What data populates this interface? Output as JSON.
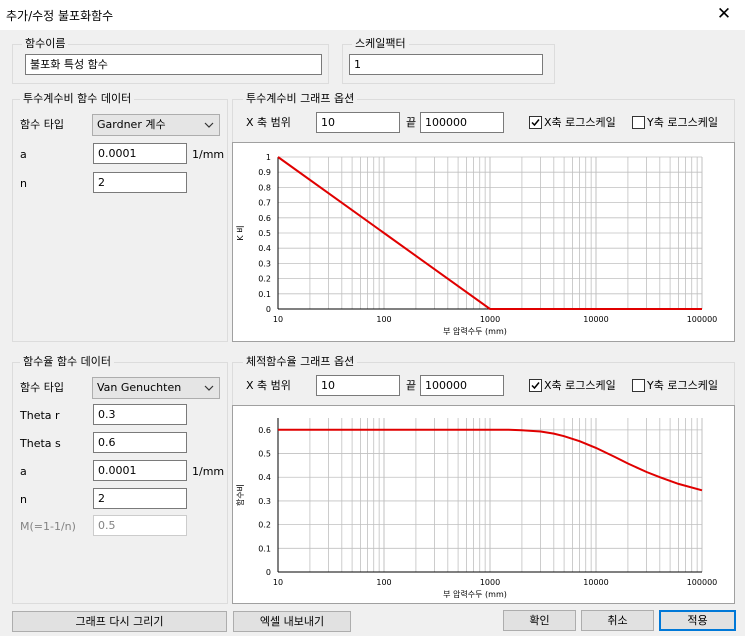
{
  "window": {
    "title": "추가/수정 불포화함수"
  },
  "function_name": {
    "label": "함수이름",
    "value": "불포화 특성 함수"
  },
  "scale_factor": {
    "label": "스케일팩터",
    "value": "1"
  },
  "conductivity": {
    "group_label": "투수계수비 함수 데이터",
    "type_label": "함수 타입",
    "type_value": "Gardner 계수",
    "a_label": "a",
    "a_value": "0.0001",
    "a_unit": "1/mm",
    "n_label": "n",
    "n_value": "2"
  },
  "conductivity_graph": {
    "group_label": "투수계수비 그래프 옵션",
    "x_range_label": "X 축 범위",
    "x_from": "10",
    "end_label": "끝",
    "x_to": "100000",
    "x_log_label": "X축 로그스케일",
    "y_log_label": "Y축 로그스케일",
    "x_log_checked": true,
    "y_log_checked": false
  },
  "water_content": {
    "group_label": "함수율 함수 데이터",
    "type_label": "함수 타입",
    "type_value": "Van Genuchten",
    "theta_r_label": "Theta r",
    "theta_r_value": "0.3",
    "theta_s_label": "Theta s",
    "theta_s_value": "0.6",
    "a_label": "a",
    "a_value": "0.0001",
    "a_unit": "1/mm",
    "n_label": "n",
    "n_value": "2",
    "m_label": "M(=1-1/n)",
    "m_value": "0.5"
  },
  "water_graph": {
    "group_label": "체적함수율 그래프 옵션",
    "x_range_label": "X 축 범위",
    "x_from": "10",
    "end_label": "끝",
    "x_to": "100000",
    "x_log_label": "X축 로그스케일",
    "y_log_label": "Y축 로그스케일",
    "x_log_checked": true,
    "y_log_checked": false
  },
  "buttons": {
    "redraw": "그래프 다시 그리기",
    "export": "엑셀 내보내기",
    "ok": "확인",
    "cancel": "취소",
    "apply": "적용"
  },
  "colors": {
    "curve": "#e00000",
    "grid": "#c0c0c0",
    "accent": "#0078d7"
  },
  "chart_data": [
    {
      "type": "line",
      "xlabel": "부 압력수두 (mm)",
      "ylabel": "K 비",
      "x_scale": "log",
      "xlim": [
        10,
        100000
      ],
      "ylim": [
        0,
        1
      ],
      "x_ticks": [
        "10",
        "100",
        "1000",
        "10000",
        "100000"
      ],
      "y_ticks": [
        "0",
        "0.1",
        "0.2",
        "0.3",
        "0.4",
        "0.5",
        "0.6",
        "0.7",
        "0.8",
        "0.9",
        "1"
      ],
      "grid": true,
      "series": [
        {
          "x": [
            10,
            100,
            1000,
            10000,
            100000
          ],
          "y": [
            1,
            0.5,
            0,
            0,
            0
          ]
        }
      ]
    },
    {
      "type": "line",
      "xlabel": "부 압력수두 (mm)",
      "ylabel": "함수비",
      "x_scale": "log",
      "xlim": [
        10,
        100000
      ],
      "ylim": [
        0,
        0.65
      ],
      "x_ticks": [
        "10",
        "100",
        "1000",
        "10000",
        "100000"
      ],
      "y_ticks": [
        "0",
        "0.1",
        "0.2",
        "0.3",
        "0.4",
        "0.5",
        "0.6"
      ],
      "grid": true,
      "series": [
        {
          "x": [
            10,
            100,
            1000,
            1500,
            2000,
            3000,
            4000,
            5000,
            7000,
            10000,
            15000,
            20000,
            30000,
            40000,
            60000,
            100000
          ],
          "y": [
            0.6,
            0.6,
            0.6,
            0.6,
            0.598,
            0.593,
            0.584,
            0.573,
            0.552,
            0.524,
            0.486,
            0.458,
            0.422,
            0.4,
            0.372,
            0.345
          ]
        }
      ]
    }
  ]
}
